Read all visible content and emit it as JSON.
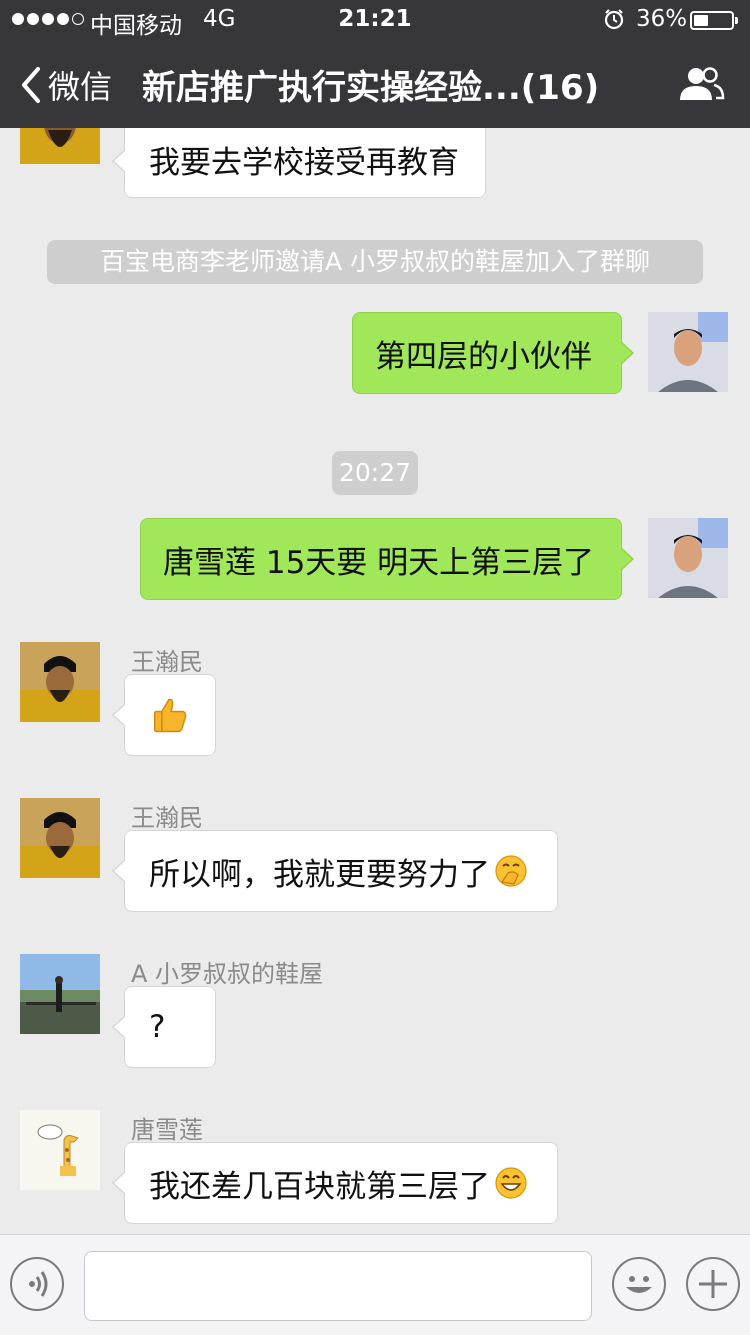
{
  "status": {
    "carrier": "中国移动",
    "network": "4G",
    "time": "21:21",
    "battery": "36%",
    "battery_level": 0.36
  },
  "nav": {
    "back_label": "微信",
    "title": "新店推广执行实操经验...(16)"
  },
  "messages": {
    "m0": {
      "text": "我要去学校接受再教育"
    },
    "m1": {
      "text": "百宝电商李老师邀请A 小罗叔叔的鞋屋加入了群聊"
    },
    "m2": {
      "text": "第四层的小伙伴"
    },
    "m3": {
      "text": "20:27"
    },
    "m4": {
      "text": "唐雪莲 15天要 明天上第三层了"
    },
    "m5": {
      "sender": "王瀚民",
      "emoji": "thumbs-up-emoji"
    },
    "m6": {
      "sender": "王瀚民",
      "text": "所以啊，我就更要努力了",
      "emoji": "hand-over-mouth-emoji"
    },
    "m7": {
      "sender": "A 小罗叔叔的鞋屋",
      "text": "?"
    },
    "m8": {
      "sender": "唐雪莲",
      "text": "我还差几百块就第三层了",
      "emoji": "grin-emoji"
    }
  },
  "input": {
    "value": "",
    "placeholder": ""
  },
  "icons": [
    "back-chevron-icon",
    "group-members-icon",
    "voice-icon",
    "emoji-icon",
    "plus-icon",
    "alarm-icon",
    "battery-icon"
  ]
}
